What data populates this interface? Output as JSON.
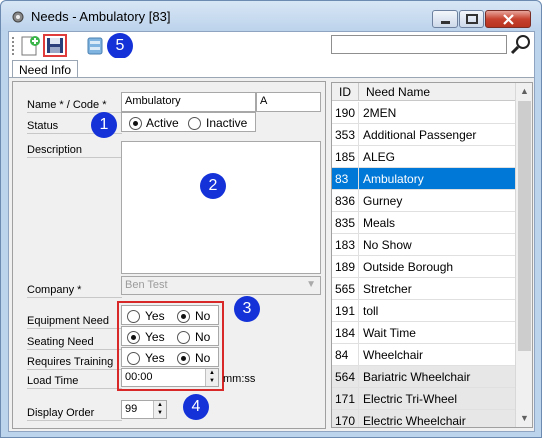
{
  "window": {
    "title": "Needs - Ambulatory [83]",
    "app_icon": "gear-app-icon"
  },
  "toolbar": {
    "new_icon": "new-document-icon",
    "save_icon": "save-disk-icon",
    "third_icon": "database-icon",
    "search_value": "",
    "search_icon": "magnifier-icon"
  },
  "tabs": [
    {
      "label": "Need Info",
      "active": true
    }
  ],
  "form": {
    "name_code_label": "Name * / Code *",
    "name_value": "Ambulatory",
    "code_value": "A",
    "status_label": "Status",
    "status_options": [
      "Active",
      "Inactive"
    ],
    "status_selected": "Active",
    "description_label": "Description",
    "description_value": "",
    "company_label": "Company *",
    "company_value": "Ben Test",
    "equipment_label": "Equipment Need",
    "seating_label": "Seating Need",
    "training_label": "Requires Training",
    "yes_label": "Yes",
    "no_label": "No",
    "equipment_selected": "No",
    "seating_selected": "Yes",
    "training_selected": "No",
    "load_time_label": "Load Time",
    "load_time_value": "00:00",
    "load_time_unit": "mm:ss",
    "display_order_label": "Display Order",
    "display_order_value": "99"
  },
  "badges": [
    "1",
    "2",
    "3",
    "4",
    "5"
  ],
  "grid": {
    "columns": [
      "ID",
      "Need Name"
    ],
    "rows": [
      {
        "id": "190",
        "name": "2MEN"
      },
      {
        "id": "353",
        "name": "Additional Passenger"
      },
      {
        "id": "185",
        "name": "ALEG"
      },
      {
        "id": "83",
        "name": "Ambulatory",
        "selected": true
      },
      {
        "id": "836",
        "name": "Gurney"
      },
      {
        "id": "835",
        "name": "Meals"
      },
      {
        "id": "183",
        "name": "No Show"
      },
      {
        "id": "189",
        "name": "Outside Borough"
      },
      {
        "id": "565",
        "name": "Stretcher"
      },
      {
        "id": "191",
        "name": "toll"
      },
      {
        "id": "184",
        "name": "Wait Time"
      },
      {
        "id": "84",
        "name": "Wheelchair"
      },
      {
        "id": "564",
        "name": "Bariatric Wheelchair",
        "inactive": true
      },
      {
        "id": "171",
        "name": "Electric Tri-Wheel",
        "inactive": true
      },
      {
        "id": "170",
        "name": "Electric Wheelchair",
        "inactive": true
      }
    ]
  },
  "colors": {
    "selection": "#0078d7",
    "badge": "#1432d8",
    "highlight": "#d92828"
  }
}
